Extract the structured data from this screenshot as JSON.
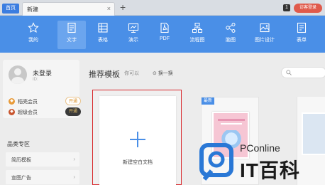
{
  "tabs": {
    "home_label": "首页",
    "active_label": "新建",
    "close_glyph": "×",
    "add_glyph": "+"
  },
  "topbar": {
    "badge_count": "1",
    "visitor_button": "访客登录"
  },
  "toolbar": {
    "items": [
      {
        "label": "我的",
        "icon": "star-icon"
      },
      {
        "label": "文字",
        "icon": "document-icon"
      },
      {
        "label": "表格",
        "icon": "table-icon"
      },
      {
        "label": "演示",
        "icon": "presentation-icon"
      },
      {
        "label": "PDF",
        "icon": "pdf-icon"
      },
      {
        "label": "流程图",
        "icon": "flowchart-icon"
      },
      {
        "label": "脑图",
        "icon": "mindmap-icon"
      },
      {
        "label": "图片设计",
        "icon": "image-design-icon"
      },
      {
        "label": "表单",
        "icon": "form-icon"
      }
    ],
    "active_index": 1
  },
  "user": {
    "name": "未登录",
    "id_label": "ID:"
  },
  "memberships": [
    {
      "label": "稻壳会员",
      "button": "开通",
      "icon_color": "#e89b3a"
    },
    {
      "label": "超级会员",
      "button": "开通",
      "icon_color": "#c8552f"
    }
  ],
  "categories": {
    "title": "品类专区",
    "items": [
      {
        "label": "简历模板",
        "arrow": "›"
      },
      {
        "label": "宣图广告",
        "arrow": "›"
      }
    ]
  },
  "main": {
    "section_title": "推荐模板",
    "hint": "你可以",
    "refresh_label": "换一换",
    "new_blank_label": "新建空白文档",
    "new_badge": "最新"
  },
  "watermark": {
    "brand_en": "PConline",
    "brand_cn": "IT百科"
  },
  "colors": {
    "accent": "#4a8fe7",
    "highlight_border": "#d8282c",
    "visitor": "#e05a4b"
  }
}
